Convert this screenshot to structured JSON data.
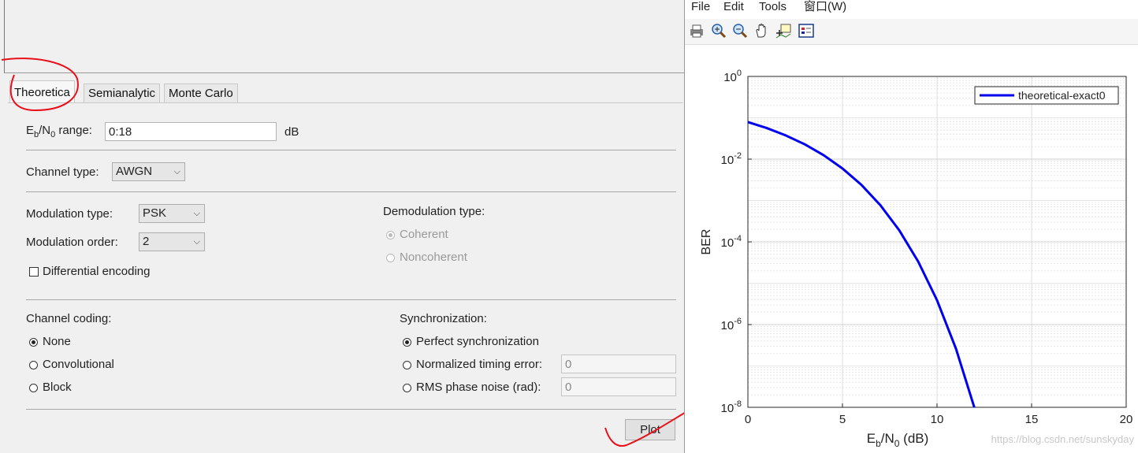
{
  "tabs": [
    "Theoretica",
    "Semianalytic",
    "Monte Carlo"
  ],
  "ebno": {
    "label_main": "E",
    "sub_b": "b",
    "slash": "/N",
    "sub_0": "0",
    "label_rest": " range:",
    "value": "0:18",
    "unit": "dB"
  },
  "channel": {
    "label": "Channel type:",
    "value": "AWGN"
  },
  "modulation": {
    "type_label": "Modulation type:",
    "type_value": "PSK",
    "order_label": "Modulation order:",
    "order_value": "2",
    "diff_label": "Differential encoding"
  },
  "demod": {
    "label": "Demodulation type:",
    "options": [
      "Coherent",
      "Noncoherent"
    ]
  },
  "coding": {
    "label": "Channel coding:",
    "options": [
      "None",
      "Convolutional",
      "Block"
    ]
  },
  "sync": {
    "label": "Synchronization:",
    "options": [
      "Perfect synchronization",
      "Normalized timing error:",
      "RMS phase noise (rad):"
    ],
    "timing_value": "0",
    "phase_value": "0"
  },
  "plot_button": "Plot",
  "figure": {
    "menus": [
      "File",
      "Edit",
      "Tools",
      "窗口(W)"
    ],
    "tools": [
      "print-icon",
      "zoom-in-icon",
      "zoom-out-icon",
      "pan-hand-icon",
      "data-cursor-icon",
      "legend-icon"
    ],
    "watermark": "https://blog.csdn.net/sunskyday"
  },
  "chart_data": {
    "type": "line",
    "xlabel_main": "E",
    "xlabel_sub_b": "b",
    "xlabel_mid": "/N",
    "xlabel_sub_0": "0",
    "xlabel_rest": " (dB)",
    "ylabel": "BER",
    "x_ticks": [
      "0",
      "5",
      "10",
      "15",
      "20"
    ],
    "y_tick_exponents": [
      "0",
      "-2",
      "-4",
      "-6",
      "-8"
    ],
    "y_tick_base": "10",
    "xlim": [
      0,
      20
    ],
    "ylim_log10": [
      -8,
      0
    ],
    "y_scale": "log",
    "grid": true,
    "legend_position": "top-right",
    "series": [
      {
        "name": "theoretical-exact0",
        "color": "#0000ee",
        "x": [
          0,
          1,
          2,
          3,
          4,
          5,
          6,
          7,
          8,
          9,
          10,
          11,
          12
        ],
        "y": [
          0.0786,
          0.0563,
          0.0375,
          0.0229,
          0.0125,
          0.00595,
          0.00239,
          0.000773,
          0.000191,
          3.36e-05,
          3.87e-06,
          2.62e-07,
          9.01e-09
        ]
      }
    ]
  }
}
